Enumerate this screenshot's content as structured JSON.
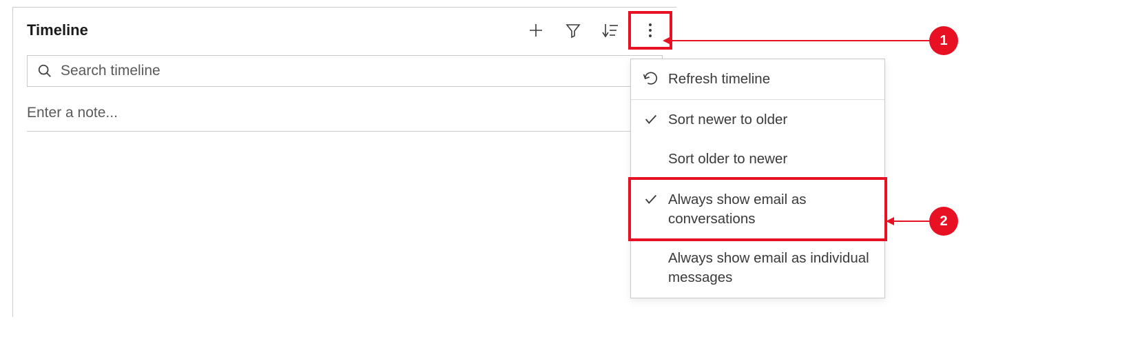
{
  "timeline": {
    "title": "Timeline",
    "search_placeholder": "Search timeline",
    "note_placeholder": "Enter a note..."
  },
  "menu": {
    "refresh": "Refresh timeline",
    "sort_newer": "Sort newer to older",
    "sort_older": "Sort older to newer",
    "email_conversations": "Always show email as conversations",
    "email_individual": "Always show email as individual messages"
  },
  "callouts": {
    "one": "1",
    "two": "2"
  }
}
